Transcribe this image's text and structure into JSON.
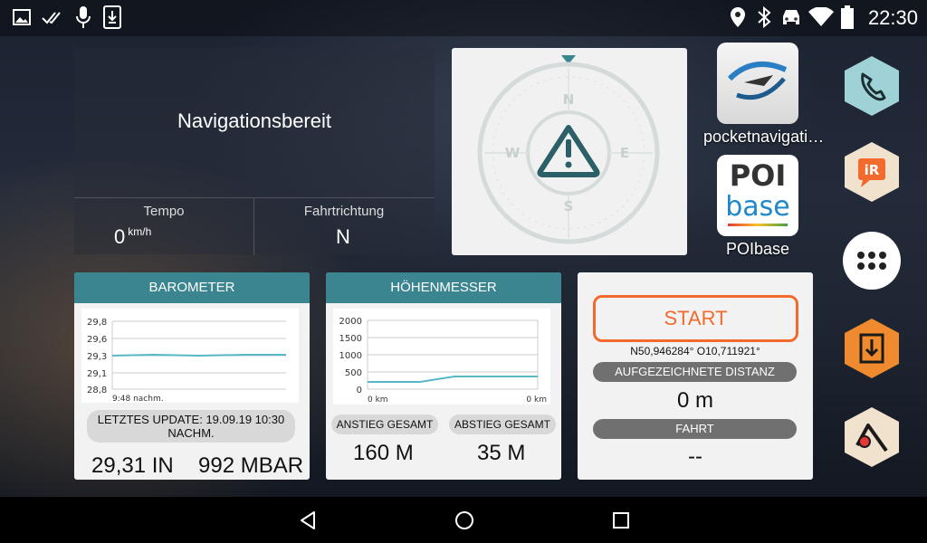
{
  "status_bar": {
    "time": "22:30",
    "left_icons": [
      "image-icon",
      "done-all-icon",
      "microphone-icon",
      "download-icon"
    ],
    "right_icons": [
      "location-icon",
      "bluetooth-icon",
      "car-icon",
      "wifi-icon",
      "battery-icon"
    ]
  },
  "nav": {
    "title": "Navigationsbereit",
    "speed_label": "Tempo",
    "speed_value": "0",
    "speed_unit": "km/h",
    "heading_label": "Fahrtrichtung",
    "heading_value": "N"
  },
  "compass": {
    "n": "N",
    "e": "E",
    "s": "S",
    "w": "W"
  },
  "apps": [
    {
      "label": "pocketnavigati…"
    },
    {
      "label": "POIbase",
      "icon_text_top": "POI",
      "icon_text_bottom": "base"
    }
  ],
  "barometer": {
    "title": "BAROMETER",
    "y_ticks": [
      "29,8",
      "29,6",
      "29,3",
      "29,1",
      "28,8"
    ],
    "x_label": "9:48 nachm.",
    "update_text": "LETZTES UPDATE: 19.09.19 10:30 NACHM.",
    "value_in": "29,31 IN",
    "value_mbar": "992 MBAR"
  },
  "altimeter": {
    "title": "HÖHENMESSER",
    "y_ticks": [
      "2000",
      "1500",
      "1000",
      "500",
      "0"
    ],
    "x_start": "0 km",
    "x_end": "0 km",
    "ascent_label": "ANSTIEG GESAMT",
    "ascent_value": "160 M",
    "descent_label": "ABSTIEG GESAMT",
    "descent_value": "35 M"
  },
  "tracker": {
    "start_label": "START",
    "coords": "N50,946284° O10,711921°",
    "distance_label": "AUFGEZEICHNETE DISTANZ",
    "distance_value": "0 m",
    "trip_label": "FAHRT",
    "trip_value": "--"
  },
  "dock": [
    {
      "icon": "phone-icon",
      "color": "#9fd2d6"
    },
    {
      "icon": "ir-icon",
      "color": "#f0e2cd"
    },
    {
      "icon": "apps-grid-icon",
      "color": "#ffffff"
    },
    {
      "icon": "download-box-icon",
      "color": "#f08a2e"
    },
    {
      "icon": "map-pin-icon",
      "color": "#f0e2cd"
    }
  ],
  "colors": {
    "accent": "#3a8590",
    "start": "#f26a2e",
    "chart_line": "#56b8c6"
  }
}
